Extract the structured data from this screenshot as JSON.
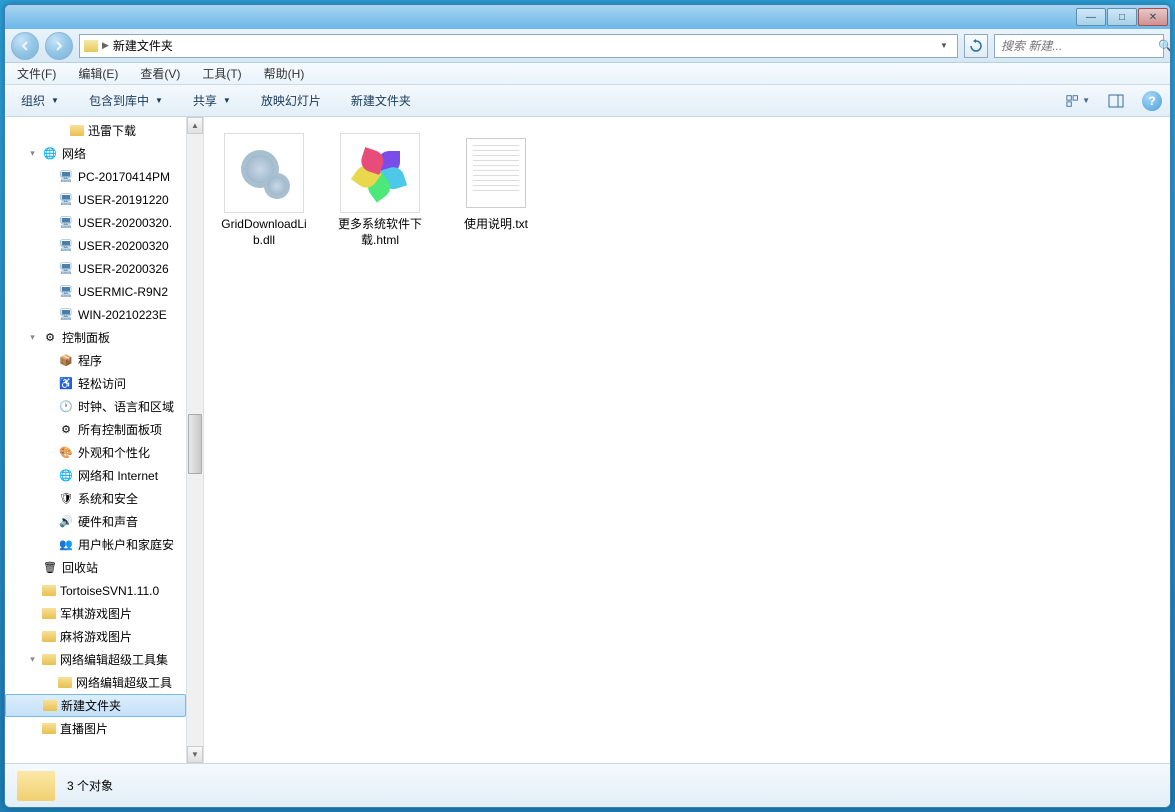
{
  "titlebar": {
    "minimize": "—",
    "maximize": "□",
    "close": "✕"
  },
  "address": {
    "path_segment": "新建文件夹",
    "separator": "▶"
  },
  "search": {
    "placeholder": "搜索 新建..."
  },
  "menubar": {
    "file": "文件(F)",
    "edit": "编辑(E)",
    "view": "查看(V)",
    "tools": "工具(T)",
    "help": "帮助(H)"
  },
  "toolbar": {
    "organize": "组织",
    "include": "包含到库中",
    "share": "共享",
    "slideshow": "放映幻灯片",
    "newfolder": "新建文件夹"
  },
  "tree": [
    {
      "level": 3,
      "icon": "folder",
      "label": "迅雷下载"
    },
    {
      "level": 1,
      "icon": "network",
      "label": "网络",
      "expander": "▼"
    },
    {
      "level": 2,
      "icon": "computer",
      "label": "PC-20170414PM"
    },
    {
      "level": 2,
      "icon": "computer",
      "label": "USER-20191220"
    },
    {
      "level": 2,
      "icon": "computer",
      "label": "USER-20200320."
    },
    {
      "level": 2,
      "icon": "computer",
      "label": "USER-20200320"
    },
    {
      "level": 2,
      "icon": "computer",
      "label": "USER-20200326"
    },
    {
      "level": 2,
      "icon": "computer",
      "label": "USERMIC-R9N2"
    },
    {
      "level": 2,
      "icon": "computer",
      "label": "WIN-20210223E"
    },
    {
      "level": 1,
      "icon": "control",
      "label": "控制面板",
      "expander": "▼"
    },
    {
      "level": 2,
      "icon": "programs",
      "label": "程序"
    },
    {
      "level": 2,
      "icon": "ease",
      "label": "轻松访问"
    },
    {
      "level": 2,
      "icon": "clock",
      "label": "时钟、语言和区域"
    },
    {
      "level": 2,
      "icon": "allcontrol",
      "label": "所有控制面板项"
    },
    {
      "level": 2,
      "icon": "appearance",
      "label": "外观和个性化"
    },
    {
      "level": 2,
      "icon": "netinet",
      "label": "网络和 Internet"
    },
    {
      "level": 2,
      "icon": "security",
      "label": "系统和安全"
    },
    {
      "level": 2,
      "icon": "sound",
      "label": "硬件和声音"
    },
    {
      "level": 2,
      "icon": "users",
      "label": "用户帐户和家庭安"
    },
    {
      "level": 1,
      "icon": "recycle",
      "label": "回收站"
    },
    {
      "level": 1,
      "icon": "folder",
      "label": "TortoiseSVN1.11.0"
    },
    {
      "level": 1,
      "icon": "folder",
      "label": "军棋游戏图片"
    },
    {
      "level": 1,
      "icon": "folder",
      "label": "麻将游戏图片"
    },
    {
      "level": 1,
      "icon": "folder",
      "label": "网络编辑超级工具集",
      "expander": "▼"
    },
    {
      "level": 2,
      "icon": "folder",
      "label": "网络编辑超级工具"
    },
    {
      "level": 1,
      "icon": "folder",
      "label": "新建文件夹",
      "selected": true
    },
    {
      "level": 1,
      "icon": "folder",
      "label": "直播图片"
    }
  ],
  "files": [
    {
      "name": "GridDownloadLib.dll",
      "type": "dll"
    },
    {
      "name": "更多系统软件下载.html",
      "type": "html"
    },
    {
      "name": "使用说明.txt",
      "type": "txt"
    }
  ],
  "status": {
    "count": "3 个对象"
  }
}
